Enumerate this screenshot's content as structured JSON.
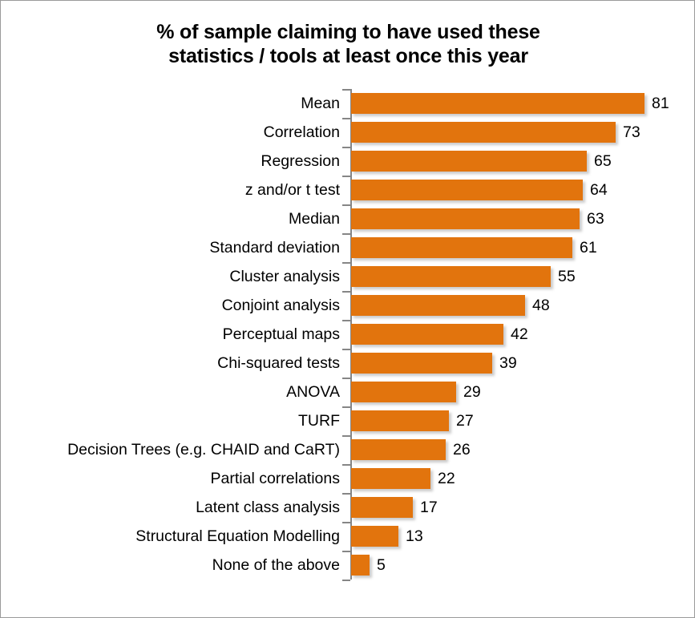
{
  "chart_data": {
    "type": "bar",
    "orientation": "horizontal",
    "title": "% of sample claiming to have used these statistics / tools at least once this year",
    "title_lines": [
      "% of sample claiming to have used these",
      "statistics / tools at least once this year"
    ],
    "xlabel": "",
    "ylabel": "",
    "xlim": [
      0,
      81
    ],
    "grid": false,
    "legend": false,
    "bar_color": "#e2740d",
    "axis_color": "#868686",
    "label_color": "#000000",
    "categories": [
      "Mean",
      "Correlation",
      "Regression",
      "z and/or t test",
      "Median",
      "Standard deviation",
      "Cluster analysis",
      "Conjoint analysis",
      "Perceptual maps",
      "Chi-squared tests",
      "ANOVA",
      "TURF",
      "Decision Trees (e.g. CHAID and CaRT)",
      "Partial correlations",
      "Latent class analysis",
      "Structural Equation Modelling",
      "None of the above"
    ],
    "values": [
      81,
      73,
      65,
      64,
      63,
      61,
      55,
      48,
      42,
      39,
      29,
      27,
      26,
      22,
      17,
      13,
      5
    ],
    "value_labels": [
      "81",
      "73",
      "65",
      "64",
      "63",
      "61",
      "55",
      "48",
      "42",
      "39",
      "29",
      "27",
      "26",
      "22",
      "17",
      "13",
      "5"
    ]
  }
}
